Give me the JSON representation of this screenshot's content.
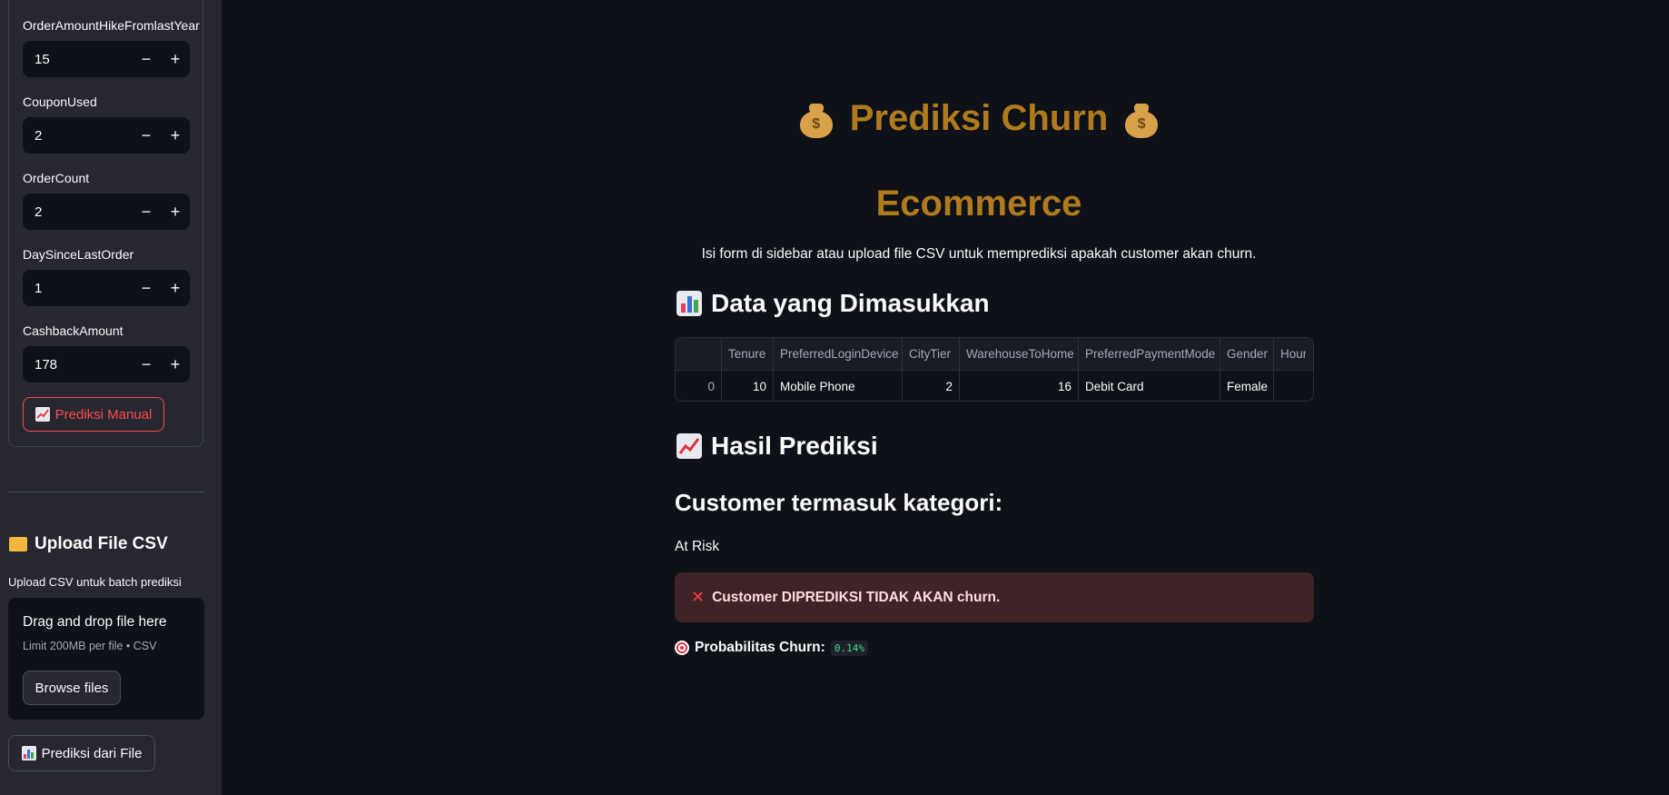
{
  "sidebar": {
    "fields": [
      {
        "label": "OrderAmountHikeFromlastYear",
        "value": "15"
      },
      {
        "label": "CouponUsed",
        "value": "2"
      },
      {
        "label": "OrderCount",
        "value": "2"
      },
      {
        "label": "DaySinceLastOrder",
        "value": "1"
      },
      {
        "label": "CashbackAmount",
        "value": "178"
      }
    ],
    "stepper_minus": "−",
    "stepper_plus": "+",
    "manual_button": "Prediksi Manual",
    "upload_heading": "Upload File CSV",
    "upload_caption": "Upload CSV untuk batch prediksi",
    "dropzone_title": "Drag and drop file here",
    "dropzone_limit": "Limit 200MB per file • CSV",
    "browse_button": "Browse files",
    "file_predict_button": "Prediksi dari File"
  },
  "main": {
    "title_line1": "Prediksi Churn",
    "title_line2": "Ecommerce",
    "subtitle": "Isi form di sidebar atau upload file CSV untuk memprediksi apakah customer akan churn.",
    "data_heading": "Data yang Dimasukkan",
    "table": {
      "columns": [
        "",
        "Tenure",
        "PreferredLoginDevice",
        "CityTier",
        "WarehouseToHome",
        "PreferredPaymentMode",
        "Gender",
        "Hour"
      ],
      "rows": [
        [
          "0",
          "10",
          "Mobile Phone",
          "2",
          "16",
          "Debit Card",
          "Female",
          ""
        ]
      ]
    },
    "result_heading": "Hasil Prediksi",
    "category_heading": "Customer termasuk kategori:",
    "category_value": "At Risk",
    "alert_text": "Customer DIPREDIKSI TIDAK AKAN churn.",
    "prob_label": "Probabilitas Churn:",
    "prob_value": "0.14%"
  },
  "colors": {
    "accent": "#ff4b4b",
    "title": "#b07a1e",
    "background": "#0e1117",
    "sidebar": "#262730"
  }
}
